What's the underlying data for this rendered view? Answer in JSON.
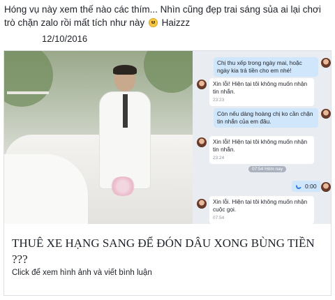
{
  "post": {
    "text_before_emoji": "Hóng vụ này xem thế nào các thím... Nhìn cũng đẹp trai sáng sủa ai lại chơi trò chặn zalo rồi mất tích như này",
    "text_after_emoji": "Haizzz",
    "emoji_icon": "sad-face-icon",
    "date": "12/10/2016"
  },
  "link_card": {
    "title": "THUÊ XE HẠNG SANG ĐỂ ĐÓN DÂU XONG BÙNG TIỀN ???",
    "subtitle": "Click để xem hình ảnh và viết bình luận"
  },
  "chat_screenshot": {
    "messages": [
      {
        "side": "out",
        "text": "Chị thu xếp trong ngày mai, hoặc ngày kia trả tiền cho em nhé!",
        "time": ""
      },
      {
        "side": "in",
        "text": "Xin lỗi! Hiện tại tôi không muốn nhận tin nhắn.",
        "time": "23:23"
      },
      {
        "side": "out",
        "text": "Còn nếu dàng hoàng chị ko cần chặn tin nhắn của em đâu.",
        "time": ""
      },
      {
        "side": "in",
        "text": "Xin lỗi! Hiện tại tôi không muốn nhận tin nhắn.",
        "time": "23:24"
      },
      {
        "side": "separator",
        "text": "07:54 Hôm nay",
        "time": ""
      },
      {
        "side": "out-call",
        "text": "0:00",
        "time": ""
      },
      {
        "side": "in",
        "text": "Xin lỗi. Hiện tại tôi không muốn nhận cuộc gọi.",
        "time": "07:54"
      }
    ]
  }
}
